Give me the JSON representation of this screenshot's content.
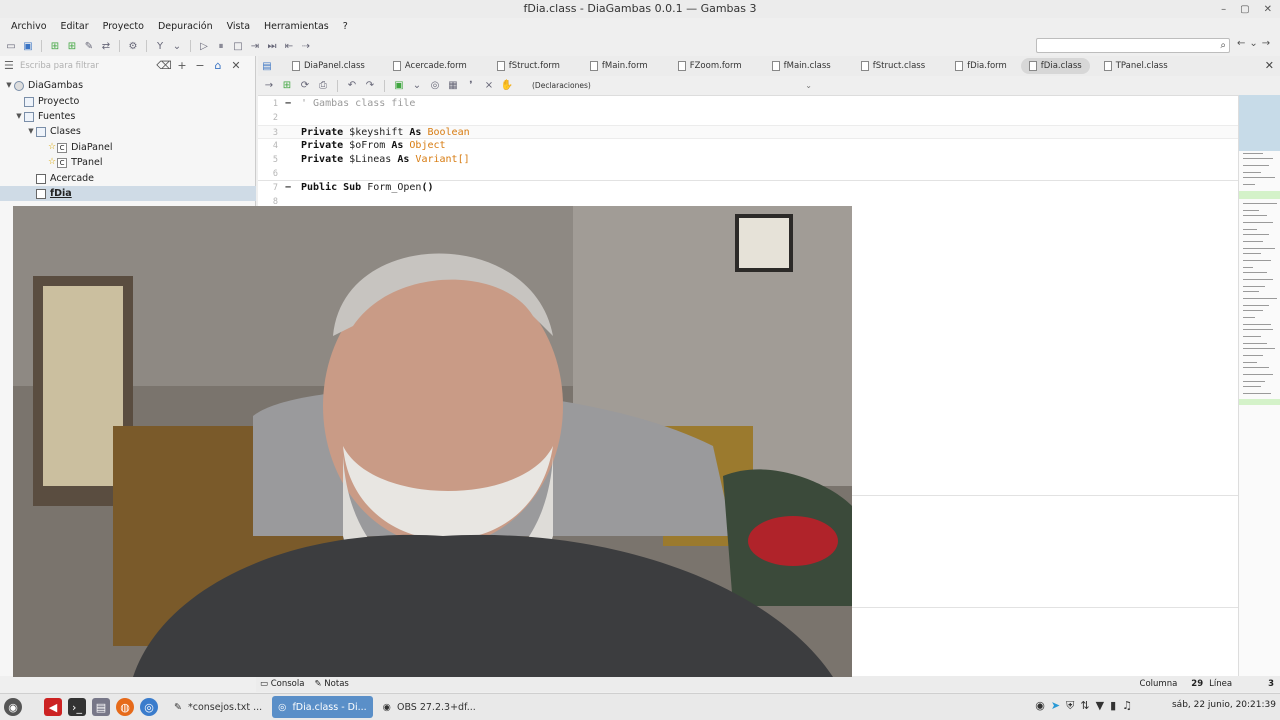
{
  "window": {
    "title": "fDia.class - DiaGambas 0.0.1 — Gambas 3",
    "controls": [
      "–",
      "▢",
      "✕"
    ]
  },
  "menubar": [
    "Archivo",
    "Editar",
    "Proyecto",
    "Depuración",
    "Vista",
    "Herramientas",
    "?"
  ],
  "search": {
    "value": ""
  },
  "sidebar": {
    "filter_placeholder": "Escriba para filtrar",
    "tree": [
      {
        "label": "DiaGambas",
        "level": 0,
        "expanded": true,
        "kind": "project"
      },
      {
        "label": "Proyecto",
        "level": 1,
        "kind": "folder"
      },
      {
        "label": "Fuentes",
        "level": 1,
        "expanded": true,
        "kind": "folder"
      },
      {
        "label": "Clases",
        "level": 2,
        "expanded": true,
        "kind": "folder"
      },
      {
        "label": "DiaPanel",
        "level": 3,
        "kind": "class"
      },
      {
        "label": "TPanel",
        "level": 3,
        "kind": "class"
      },
      {
        "label": "Acercade",
        "level": 2,
        "kind": "form"
      },
      {
        "label": "fDia",
        "level": 2,
        "kind": "form",
        "selected": true
      }
    ]
  },
  "tabs": [
    {
      "label": "DiaPanel.class"
    },
    {
      "label": "Acercade.form"
    },
    {
      "label": "fStruct.form"
    },
    {
      "label": "fMain.form"
    },
    {
      "label": "FZoom.form"
    },
    {
      "label": "fMain.class"
    },
    {
      "label": "fStruct.class"
    },
    {
      "label": "fDia.form"
    },
    {
      "label": "fDia.class",
      "active": true
    },
    {
      "label": "TPanel.class"
    }
  ],
  "editor_toolbar": {
    "declarations": "(Declaraciones)"
  },
  "code": [
    {
      "ln": "1",
      "fold": "−",
      "tokens": [
        {
          "t": "' Gambas class file",
          "c": "cm"
        }
      ]
    },
    {
      "ln": "2",
      "tokens": []
    },
    {
      "ln": "3",
      "current": true,
      "tokens": [
        {
          "t": "Private",
          "c": "kw"
        },
        {
          "t": " $keyshift ",
          "c": ""
        },
        {
          "t": "As",
          "c": "kw"
        },
        {
          "t": " ",
          "c": ""
        },
        {
          "t": "Boolean",
          "c": "ty"
        }
      ]
    },
    {
      "ln": "4",
      "tokens": [
        {
          "t": "Private",
          "c": "kw"
        },
        {
          "t": " $oFrom ",
          "c": ""
        },
        {
          "t": "As",
          "c": "kw"
        },
        {
          "t": " ",
          "c": ""
        },
        {
          "t": "Object",
          "c": "ty"
        }
      ]
    },
    {
      "ln": "5",
      "tokens": [
        {
          "t": "Private",
          "c": "kw"
        },
        {
          "t": " $Lineas ",
          "c": ""
        },
        {
          "t": "As",
          "c": "kw"
        },
        {
          "t": " ",
          "c": ""
        },
        {
          "t": "Variant[]",
          "c": "ty"
        }
      ]
    },
    {
      "ln": "6",
      "sep": true,
      "tokens": []
    },
    {
      "ln": "7",
      "fold": "−",
      "tokens": [
        {
          "t": "Public Sub",
          "c": "kw"
        },
        {
          "t": " Form_Open",
          "c": ""
        },
        {
          "t": "()",
          "c": "kw"
        }
      ]
    },
    {
      "ln": "8",
      "tokens": []
    }
  ],
  "statusbar": {
    "tabs": [
      "Consola",
      "Notas"
    ],
    "column_label": "Columna",
    "column_value": "29",
    "line_label": "Línea",
    "line_value": "3"
  },
  "taskbar": {
    "tasks": [
      {
        "label": "*consejos.txt ...",
        "active": false
      },
      {
        "label": "fDia.class - Di...",
        "active": true
      },
      {
        "label": "OBS 27.2.3+df...",
        "active": false
      }
    ],
    "clock": "sáb, 22 junio, 20:21:39"
  },
  "colors": {
    "keyword": "#111111",
    "type": "#d77b10",
    "comment": "#9a9a9a",
    "active_task": "#5a8fc8"
  }
}
